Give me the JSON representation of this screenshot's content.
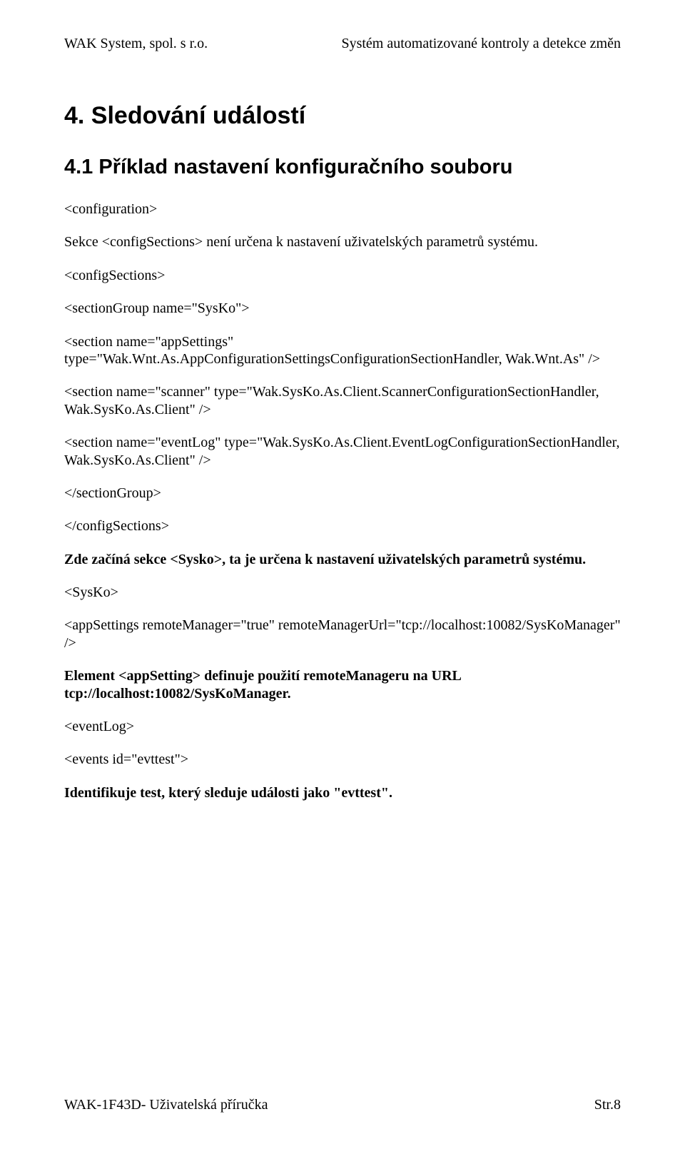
{
  "header": {
    "left": "WAK System, spol. s r.o.",
    "right": "Systém automatizované kontroly a detekce změn"
  },
  "h1": "4. Sledování událostí",
  "h2": "4.1 Příklad nastavení konfiguračního souboru",
  "p1": "<configuration>",
  "p2a": "Sekce ",
  "p2b": "<configSections>",
  "p2c": " není určena k nastavení uživatelských parametrů systému.",
  "p3": "<configSections>",
  "p4": "<sectionGroup name=\"SysKo\">",
  "p5": "<section name=\"appSettings\" type=\"Wak.Wnt.As.AppConfigurationSettingsConfigurationSectionHandler, Wak.Wnt.As\" />",
  "p6": "<section name=\"scanner\" type=\"Wak.SysKo.As.Client.ScannerConfigurationSectionHandler, Wak.SysKo.As.Client\" />",
  "p7": "<section name=\"eventLog\" type=\"Wak.SysKo.As.Client.EventLogConfigurationSectionHandler, Wak.SysKo.As.Client\" />",
  "p8": "</sectionGroup>",
  "p9": "</configSections>",
  "p10a": "Zde  začíná sekce ",
  "p10b": "<Sysko>",
  "p10c": ", ta je určena k nastavení uživatelských parametrů systému.",
  "p11": "<SysKo>",
  "p12": "<appSettings remoteManager=\"true\" remoteManagerUrl=\"tcp://localhost:10082/SysKoManager\" />",
  "p13": "Element <appSetting> definuje použití remoteManageru na URL tcp://localhost:10082/SysKoManager.",
  "p14": "<eventLog>",
  "p15": "<events id=\"evttest\">",
  "p16": "Identifikuje test, který sleduje události jako \"evttest\".",
  "footer": {
    "left": "WAK-1F43D- Uživatelská příručka",
    "right": "Str.8"
  }
}
